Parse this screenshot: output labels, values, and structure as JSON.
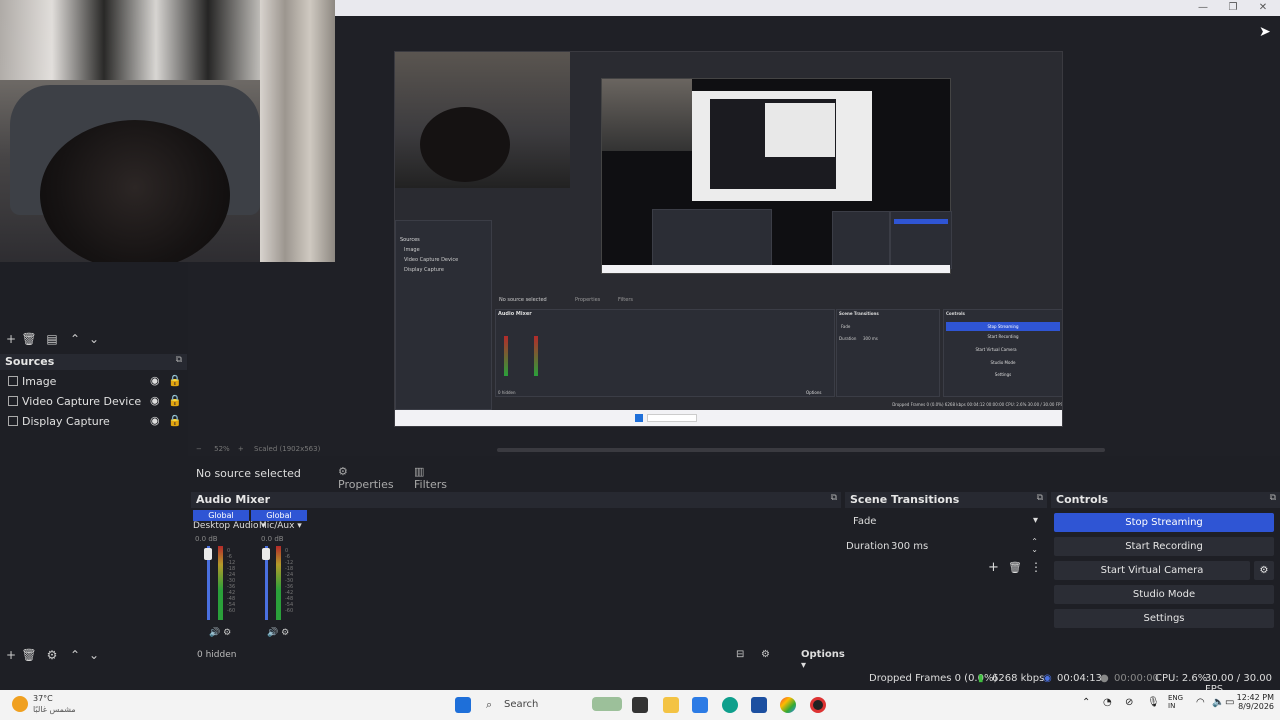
{
  "colors": {
    "accent": "#2f55d4",
    "panel_bg": "#1e1f25",
    "dock_header": "#272931"
  },
  "titlebar": {
    "minimize": "—",
    "maximize": "❐",
    "close": "✕"
  },
  "preview": {
    "zoom_text": "52%",
    "scale_text": "Scaled (1902x563)",
    "nested": {
      "sources_label": "Sources",
      "items": [
        "Image",
        "Video Capture Device",
        "Display Capture"
      ],
      "no_source": "No source selected",
      "properties": "Properties",
      "filters": "Filters",
      "audio_mixer": "Audio Mixer",
      "scene_transitions": "Scene Transitions",
      "controls": "Controls",
      "stop_streaming": "Stop Streaming",
      "start_recording": "Start Recording",
      "start_virtual_camera": "Start Virtual Camera",
      "studio_mode": "Studio Mode",
      "settings": "Settings",
      "fade": "Fade",
      "duration_label": "Duration",
      "duration_value": "300 ms",
      "hidden": "0 hidden",
      "options": "Options",
      "status": "Dropped Frames 0 (0.0%)  6268 kbps  00:04:12  00:00:00  CPU: 2.6%  30.00 / 30.00 FPS"
    }
  },
  "sources": {
    "title": "Sources",
    "items": [
      {
        "label": "Image"
      },
      {
        "label": "Video Capture Device"
      },
      {
        "label": "Display Capture"
      }
    ]
  },
  "sourcebar": {
    "no_source": "No source selected",
    "properties": "Properties",
    "filters": "Filters"
  },
  "audio_mixer": {
    "title": "Audio Mixer",
    "channels": [
      {
        "tag": "Global",
        "name": "Desktop Audio",
        "db": "0.0 dB"
      },
      {
        "tag": "Global",
        "name": "Mic/Aux",
        "db": "0.0 dB"
      }
    ],
    "ticks": [
      "0",
      "-6",
      "-12",
      "-18",
      "-24",
      "-30",
      "-36",
      "-42",
      "-48",
      "-54",
      "-60"
    ],
    "hidden": "0 hidden",
    "options": "Options"
  },
  "scene_transitions": {
    "title": "Scene Transitions",
    "transition": "Fade",
    "duration_label": "Duration",
    "duration_value": "300 ms"
  },
  "controls": {
    "title": "Controls",
    "stop_streaming": "Stop Streaming",
    "start_recording": "Start Recording",
    "start_virtual_camera": "Start Virtual Camera",
    "studio_mode": "Studio Mode",
    "settings": "Settings"
  },
  "status": {
    "dropped_frames": "Dropped Frames 0 (0.0%)",
    "bitrate": "6268 kbps",
    "stream_time": "00:04:13",
    "rec_time": "00:00:00",
    "cpu": "CPU: 2.6%",
    "fps": "30.00 / 30.00 FPS"
  },
  "taskbar": {
    "weather_temp": "37°C",
    "weather_desc": "مشمس غالبًا",
    "search": "Search",
    "lang": "ENG",
    "region": "IN",
    "time": "12:42 PM",
    "date": "8/9/2026"
  }
}
